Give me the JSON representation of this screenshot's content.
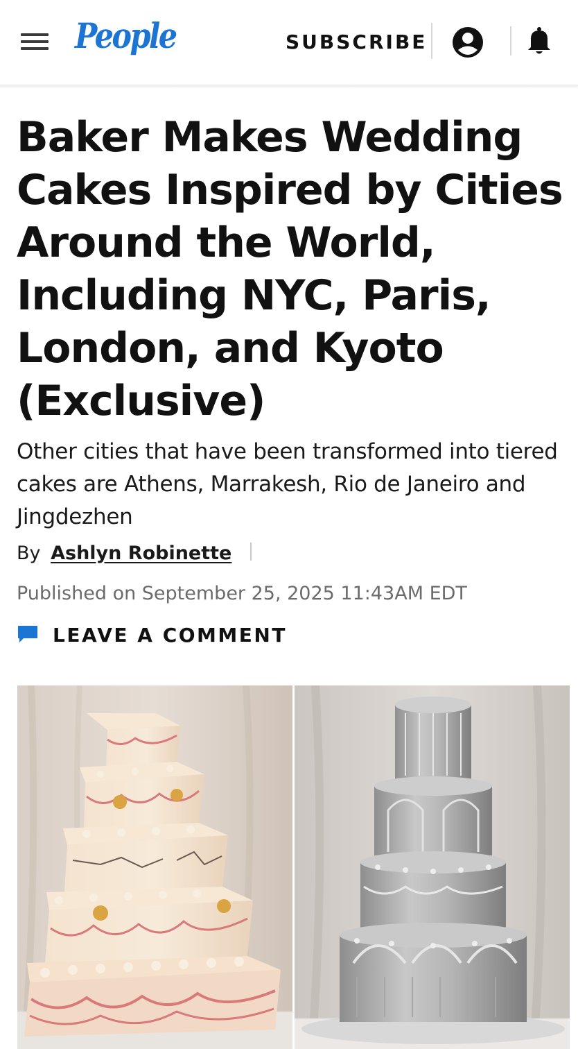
{
  "header": {
    "logo_text": "People",
    "subscribe_label": "SUBSCRIBE",
    "menu_icon": "hamburger-menu-icon",
    "account_icon": "account-icon",
    "notifications_icon": "bell-icon",
    "brand_color": "#1d75d3"
  },
  "article": {
    "headline": "Baker Makes Wedding Cakes Inspired by Cities Around the World, Including NYC, Paris, London, and Kyoto (Exclusive)",
    "dek": "Other cities that have been transformed into tiered cakes are Athens, Marrakesh, Rio de Janeiro and Jingdezhen",
    "byline_prefix": "By",
    "author": "Ashlyn Robinette",
    "published": "Published on September 25, 2025 11:43AM EDT",
    "comment_label": "LEAVE A COMMENT",
    "comment_icon": "comment-icon",
    "comment_icon_color": "#1d75d3"
  },
  "gallery": {
    "left_image": "pink-and-cream-square-tiered-wedding-cake",
    "right_image": "silver-round-tiered-wedding-cake"
  }
}
